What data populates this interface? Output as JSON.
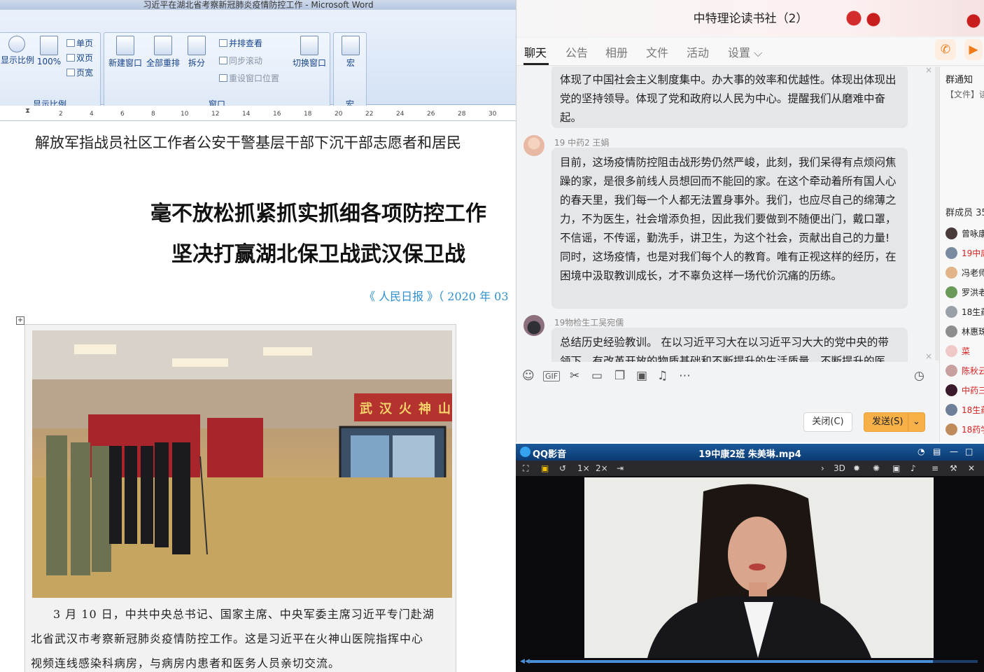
{
  "word": {
    "title": "习近平在湖北省考察新冠肺炎疫情防控工作 - Microsoft Word",
    "ribbon": {
      "zoom_label": "显示比例",
      "zoom_100": "100%",
      "single_page": "单页",
      "two_page": "双页",
      "page_width": "页宽",
      "group_zoom": "显示比例",
      "new_window": "新建窗口",
      "arrange_all": "全部重排",
      "split": "拆分",
      "view_side_by_side": "并排查看",
      "sync_scroll": "同步滚动",
      "reset_position": "重设窗口位置",
      "switch_windows": "切换窗口",
      "group_window": "窗口",
      "macros": "宏",
      "group_macros": "宏"
    },
    "ruler": [
      "2",
      "4",
      "6",
      "8",
      "10",
      "12",
      "14",
      "16",
      "18",
      "20",
      "22",
      "24",
      "26",
      "28",
      "30"
    ],
    "doc": {
      "line1": "解放军指战员社区工作者公安干警基层干部下沉干部志愿者和居民",
      "headline1": "毫不放松抓紧抓实抓细各项防控工作",
      "headline2": "坚决打赢湖北保卫战武汉保卫战",
      "source": "《 人民日报 》（ 2020 年 03",
      "photo_banner": "武汉火神山",
      "caption1": "3 月 10 日，中共中央总书记、国家主席、中央军委主席习近平专门赴湖",
      "caption2": "北省武汉市考察新冠肺炎疫情防控工作。这是习近平在火神山医院指挥中心",
      "caption3": "视频连线感染科病房，与病房内患者和医务人员亲切交流。"
    }
  },
  "qq": {
    "title": "中特理论读书社（2）",
    "tabs": [
      "聊天",
      "公告",
      "相册",
      "文件",
      "活动",
      "设置 ⌵"
    ],
    "messages": [
      {
        "sender": "",
        "text": "体现了中国社会主义制度集中。办大事的效率和优越性。体现出体现出党的坚持领导。体现了党和政府以人民为中心。提醒我们从磨难中奋起。"
      },
      {
        "sender": "19 中药2 王娟",
        "text": "目前，这场疫情防控阻击战形势仍然严峻，此刻，我们呆得有点烦闷焦躁的家，是很多前线人员想回而不能回的家。在这个牵动着所有国人心的春天里，我们每一个人都无法置身事外。我们，也应尽自己的绵薄之力，不为医生，社会增添负担，因此我们要做到不随便出门，戴口罩，不信谣，不传谣，勤洗手，讲卫生，为这个社会，贡献出自己的力量!同时，这场疫情，也是对我们每个人的教育。唯有正视这样的经历，在困境中汲取教训成长，才不辜负这样一场代价沉痛的历练。"
      },
      {
        "sender": "19物检生工吴宛儒",
        "text": "总结历史经验教训。 在以习近平习大在以习近平习大大的党中央的带领下，有改革开放的物质基础和不断提升的生活质量，不断提升的医"
      }
    ],
    "close_label": "关闭(C)",
    "send_label": "发送(S)",
    "side": {
      "notice_title": "群通知",
      "notice_text": "【文件】读",
      "members_title": "群成员 35",
      "members": [
        {
          "name": "曾咏康",
          "color": "#222222"
        },
        {
          "name": "19中康",
          "color": "#d42020"
        },
        {
          "name": "冯老师",
          "color": "#222222"
        },
        {
          "name": "罗洪老",
          "color": "#222222"
        },
        {
          "name": "18生药",
          "color": "#222222"
        },
        {
          "name": "林惠珠",
          "color": "#222222"
        },
        {
          "name": "菜",
          "color": "#d42020"
        },
        {
          "name": "陈秋云",
          "color": "#d42020"
        },
        {
          "name": "中药三",
          "color": "#d42020"
        },
        {
          "name": "18生药",
          "color": "#d42020"
        },
        {
          "name": "18药学",
          "color": "#d42020"
        }
      ]
    }
  },
  "player": {
    "app": "QQ影音",
    "file": "19中康2班 朱美琳.mp4",
    "speed1": "1×",
    "speed2": "2×",
    "mode_3d": "3D",
    "progress": 0.9
  }
}
